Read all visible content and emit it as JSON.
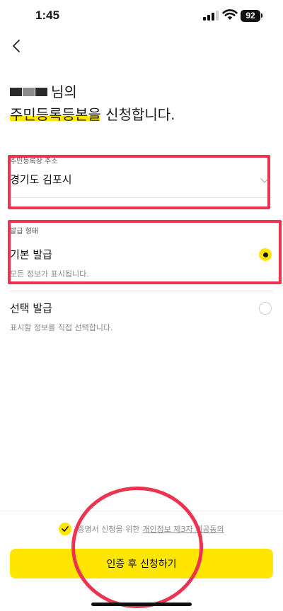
{
  "status_bar": {
    "time": "1:45",
    "battery": "92",
    "icons": [
      "signal-icon",
      "wifi-icon",
      "battery-icon"
    ]
  },
  "nav": {
    "back_icon": "chevron-left-icon"
  },
  "heading": {
    "name_suffix": "님의",
    "title_highlight": "주민등록등본을",
    "title_rest": " 신청합니다."
  },
  "address": {
    "label": "주민등록상 주소",
    "value": "경기도 김포시",
    "icon": "chevron-down-icon"
  },
  "issuance": {
    "label": "발급 형태",
    "options": [
      {
        "title": "기본 발급",
        "description": "모든 정보가 표시됩니다.",
        "selected": true
      },
      {
        "title": "선택 발급",
        "description": "표시할 정보를 직접 선택합니다.",
        "selected": false
      }
    ]
  },
  "consent": {
    "text": "증명서 신청을 위한",
    "link": "개인정보 제3자 제공동의",
    "checked": true
  },
  "cta": {
    "label": "인증 후 신청하기"
  },
  "colors": {
    "accent": "#ffe600",
    "markup": "#ee3350",
    "mask_dark": "#2b2b2b",
    "mask_mid": "#8c8c8c"
  }
}
